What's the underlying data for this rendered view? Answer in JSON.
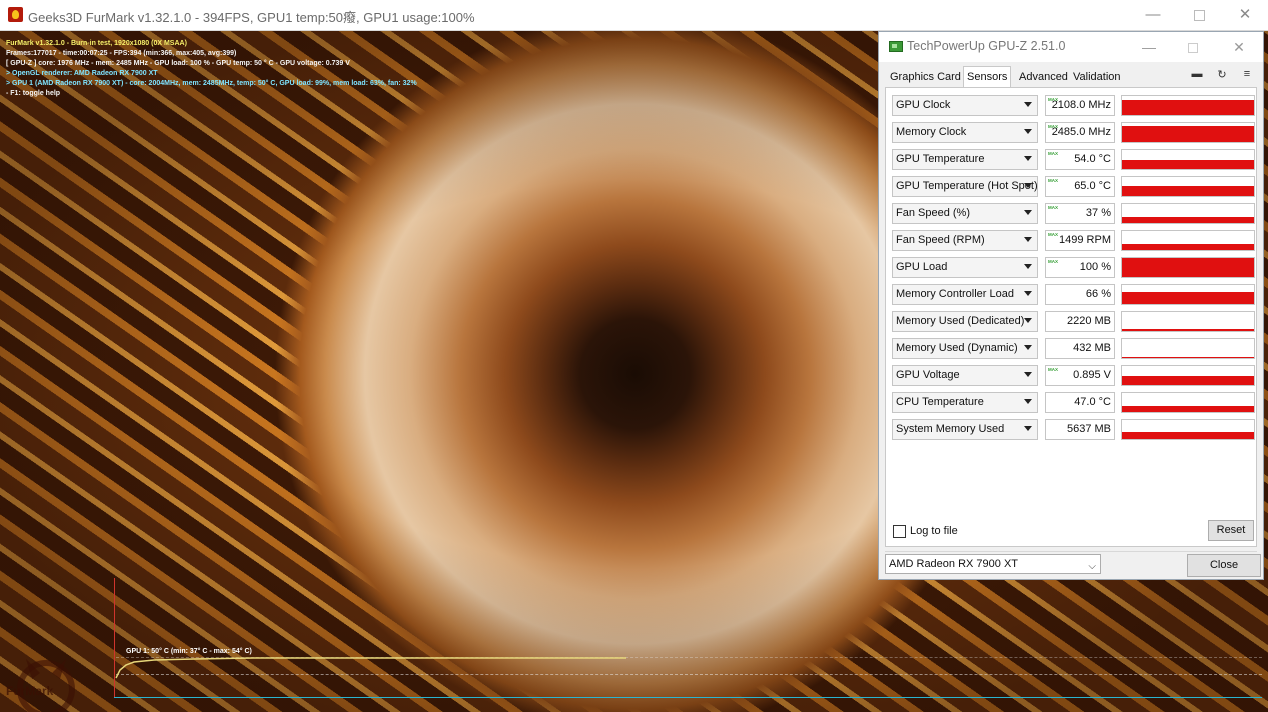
{
  "furmark": {
    "title": "Geeks3D FurMark v1.32.1.0 - 394FPS, GPU1 temp:50癈, GPU1 usage:100%",
    "osd": [
      "FurMark v1.32.1.0 - Burn-in test, 1920x1080 (0X MSAA)",
      "Frames:177017 - time:00:07:25 - FPS:394 (min:366, max:405, avg:399)",
      "[ GPU-Z ] core: 1976 MHz - mem: 2485 MHz - GPU load: 100 % - GPU temp: 50 ° C - GPU voltage: 0.739 V",
      "> OpenGL renderer: AMD Radeon RX 7900 XT",
      "> GPU 1 (AMD Radeon RX 7900 XT) - core: 2004MHz, mem: 2485MHz, temp: 50° C, GPU load: 99%, mem load: 63%, fan: 32%",
      "- F1: toggle help"
    ],
    "graph_label": "GPU 1: 50° C (min: 37° C - max: 54° C)",
    "logo_text": "FurMark",
    "colors": {
      "osd_yellow": "#f6f06a",
      "osd_cyan": "#7fe3ff",
      "graph_line": "#e8d77a"
    }
  },
  "gpuz": {
    "title": "TechPowerUp GPU-Z 2.51.0",
    "tabs": [
      {
        "label": "Graphics Card",
        "active": false
      },
      {
        "label": "Sensors",
        "active": true
      },
      {
        "label": "Advanced",
        "active": false
      },
      {
        "label": "Validation",
        "active": false
      }
    ],
    "toolbar_icons": [
      "camera-icon",
      "refresh-icon",
      "menu-icon"
    ],
    "max_tag": "MAX",
    "sensors": [
      {
        "name": "GPU Clock",
        "value": "2108.0 MHz",
        "max": true,
        "level": 0.78
      },
      {
        "name": "Memory Clock",
        "value": "2485.0 MHz",
        "max": true,
        "level": 0.85
      },
      {
        "name": "GPU Temperature",
        "value": "54.0 °C",
        "max": true,
        "level": 0.45
      },
      {
        "name": "GPU Temperature (Hot Spot)",
        "value": "65.0 °C",
        "max": true,
        "level": 0.5
      },
      {
        "name": "Fan Speed (%)",
        "value": "37 %",
        "max": true,
        "level": 0.3
      },
      {
        "name": "Fan Speed (RPM)",
        "value": "1499 RPM",
        "max": true,
        "level": 0.32
      },
      {
        "name": "GPU Load",
        "value": "100 %",
        "max": true,
        "level": 1.0
      },
      {
        "name": "Memory Controller Load",
        "value": "66 %",
        "max": false,
        "level": 0.62
      },
      {
        "name": "Memory Used (Dedicated)",
        "value": "2220 MB",
        "max": false,
        "level": 0.12
      },
      {
        "name": "Memory Used (Dynamic)",
        "value": "432 MB",
        "max": false,
        "level": 0.05
      },
      {
        "name": "GPU Voltage",
        "value": "0.895 V",
        "max": true,
        "level": 0.45
      },
      {
        "name": "CPU Temperature",
        "value": "47.0 °C",
        "max": false,
        "level": 0.3
      },
      {
        "name": "System Memory Used",
        "value": "5637 MB",
        "max": false,
        "level": 0.35
      }
    ],
    "log_to_file_label": "Log to file",
    "reset_label": "Reset",
    "device_select": "AMD Radeon RX 7900 XT",
    "close_label": "Close",
    "colors": {
      "sensor_graph": "#e01010",
      "max_tag": "#38a038"
    }
  }
}
